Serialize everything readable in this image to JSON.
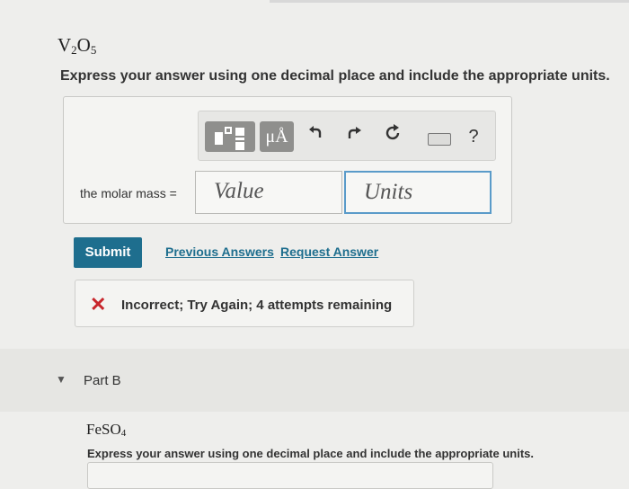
{
  "part_a": {
    "formula": {
      "base": "V",
      "sub1": "2",
      "mid": "O",
      "sub2": "5"
    },
    "instruction": "Express your answer using one decimal place and include the appropriate units.",
    "toolbar": {
      "template_icon": "templates-icon",
      "units_label": "μÅ",
      "undo_icon": "undo-icon",
      "redo_icon": "redo-icon",
      "reset_icon": "reset-icon",
      "keyboard_icon": "keyboard-icon",
      "help_label": "?"
    },
    "answer_label": "the molar mass =",
    "value_placeholder": "Value",
    "units_placeholder": "Units",
    "submit_label": "Submit",
    "previous_answers_label": "Previous Answers",
    "request_answer_label": "Request Answer",
    "feedback": {
      "icon": "incorrect-x-icon",
      "text": "Incorrect; Try Again; 4 attempts remaining"
    }
  },
  "part_b": {
    "label": "Part B",
    "formula": {
      "base": "FeSO",
      "sub": "4"
    },
    "instruction": "Express your answer using one decimal place and include the appropriate units."
  },
  "colors": {
    "accent": "#1e6e8e",
    "error": "#c8262c",
    "units_focus": "#5a9bc9"
  }
}
